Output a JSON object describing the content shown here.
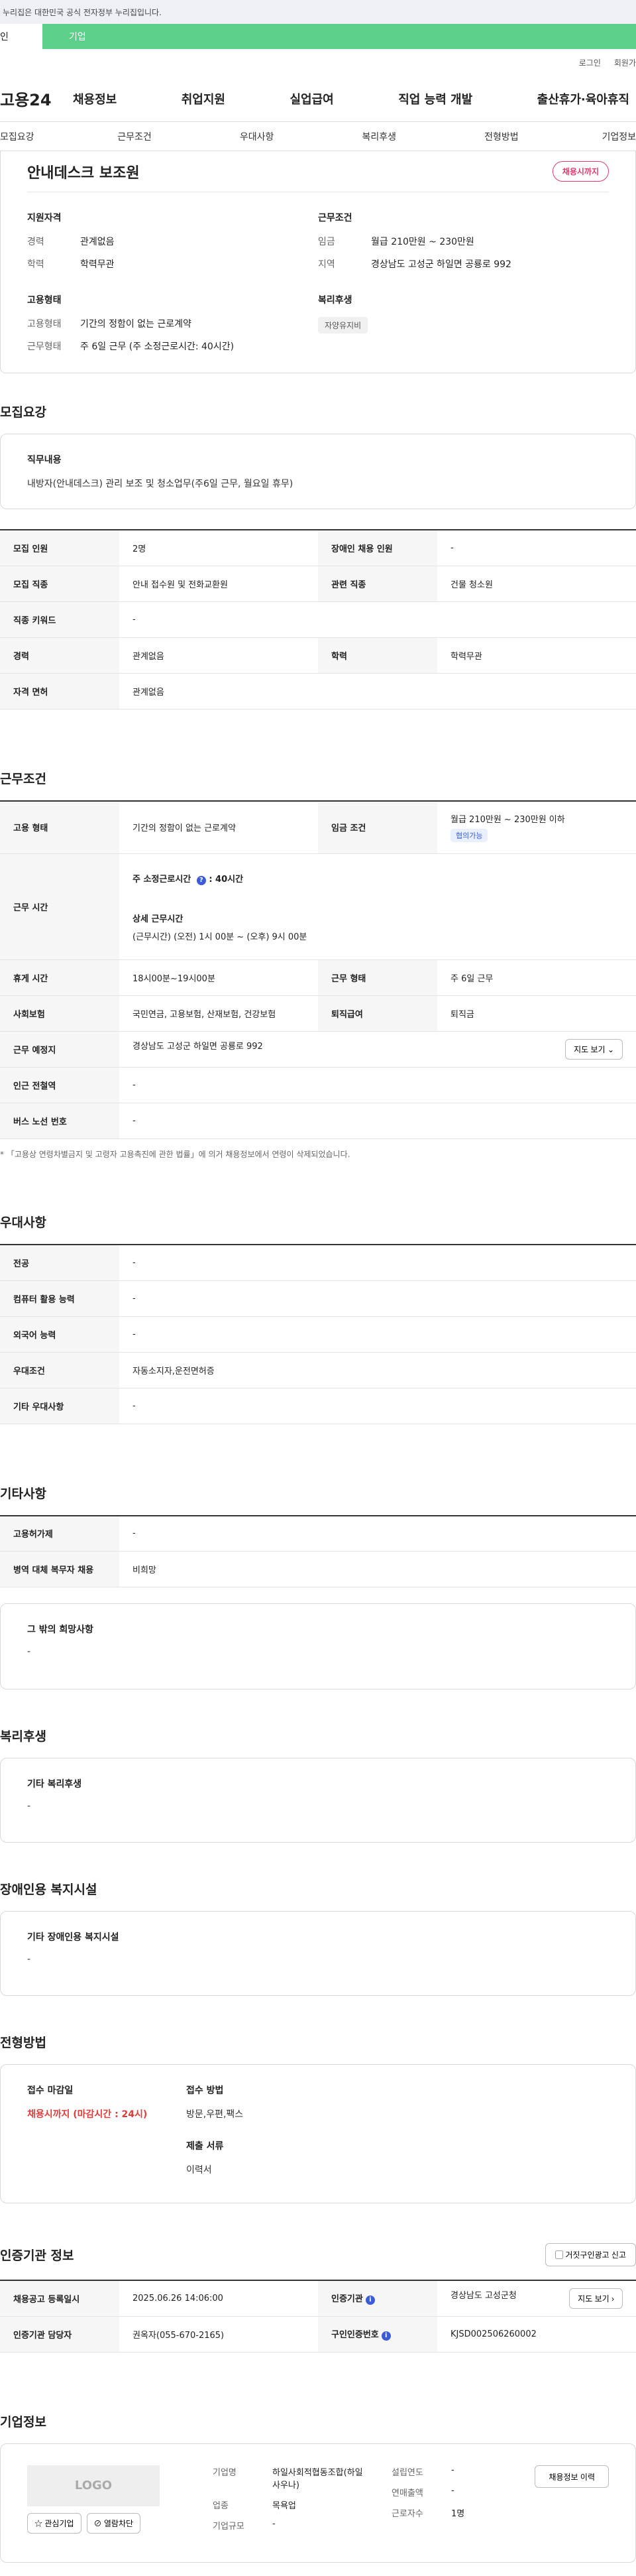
{
  "gov_bar": "누리집은 대한민국 공식 전자정부 누리집입니다.",
  "user_tabs": {
    "individual": "인",
    "company": "기업"
  },
  "util": {
    "login": "로그인",
    "join": "회원가"
  },
  "logo": "고용24",
  "gnb": [
    "채용정보",
    "취업지원",
    "실업급여",
    "직업 능력 개발",
    "출산휴가·육아휴직"
  ],
  "subtabs": [
    "모집요강",
    "근무조건",
    "우대사항",
    "복리후생",
    "전형방법",
    "기업정보"
  ],
  "summary": {
    "title": "안내데스크 보조원",
    "status": "채용시까지",
    "qual_title": "지원자격",
    "qual": [
      {
        "k": "경력",
        "v": "관계없음"
      },
      {
        "k": "학력",
        "v": "학력무관"
      }
    ],
    "cond_title": "근무조건",
    "cond": [
      {
        "k": "임금",
        "v": "월급 210만원 ~ 230만원"
      },
      {
        "k": "지역",
        "v": "경상남도 고성군 하일면 공룡로 992"
      }
    ],
    "emp_title": "고용형태",
    "emp": [
      {
        "k": "고용형태",
        "v": "기간의 정함이 없는 근로계약"
      },
      {
        "k": "근무형태",
        "v": "주 6일 근무 (주 소정근로시간: 40시간)"
      }
    ],
    "welfare_title": "복리후생",
    "welfare_chip": "자양유지비"
  },
  "recruit": {
    "section": "모집요강",
    "job_title": "직무내용",
    "job_text": "내방자(안내데스크) 관리 보조 및 청소업무(주6일 근무, 월요일 휴무)",
    "rows": [
      [
        {
          "k": "모집 인원",
          "v": "2명"
        },
        {
          "k": "장애인 채용 인원",
          "v": "-"
        }
      ],
      [
        {
          "k": "모집 직종",
          "v": "안내 접수원 및 전화교환원"
        },
        {
          "k": "관련 직종",
          "v": "건물 청소원"
        }
      ],
      [
        {
          "k": "직종 키워드",
          "v": "-"
        }
      ],
      [
        {
          "k": "경력",
          "v": "관계없음"
        },
        {
          "k": "학력",
          "v": "학력무관"
        }
      ],
      [
        {
          "k": "자격 면허",
          "v": "관계없음"
        }
      ]
    ]
  },
  "work": {
    "section": "근무조건",
    "emp_type_k": "고용 형태",
    "emp_type_v": "기간의 정함이 없는 근로계약",
    "wage_k": "임금 조건",
    "wage_v": "월급 210만원 ~ 230만원 이하",
    "wage_chip": "협의가능",
    "time_k": "근무 시간",
    "time_main": "주 소정근로시간",
    "time_main_v": ": 40시간",
    "time_detail_title": "상세 근무시간",
    "time_detail": "(근무시간) (오전) 1시 00분 ~ (오후) 9시 00분",
    "rest_k": "휴게 시간",
    "rest_v": "18시00분~19시00분",
    "form_k": "근무 형태",
    "form_v": "주 6일 근무",
    "ins_k": "사회보험",
    "ins_v": "국민연금, 고용보험, 산재보험, 건강보험",
    "sev_k": "퇴직급여",
    "sev_v": "퇴직금",
    "place_k": "근무 예정지",
    "place_v": "경상남도 고성군 하일면 공룡로 992",
    "map_btn": "지도 보기",
    "subway_k": "인근 전철역",
    "subway_v": "-",
    "bus_k": "버스 노선 번호",
    "bus_v": "-",
    "note": "* 「고용상 연령차별금지 및 고령자 고용촉진에 관한 법률」에 의거 채용정보에서 연령이 삭제되었습니다."
  },
  "pref": {
    "section": "우대사항",
    "rows": [
      {
        "k": "전공",
        "v": "-"
      },
      {
        "k": "컴퓨터 활용 능력",
        "v": "-"
      },
      {
        "k": "외국어 능력",
        "v": "-"
      },
      {
        "k": "우대조건",
        "v": "자동소지자,운전면허증"
      },
      {
        "k": "기타 우대사항",
        "v": "-"
      }
    ]
  },
  "etc": {
    "section": "기타사항",
    "rows": [
      {
        "k": "고용허가제",
        "v": "-"
      },
      {
        "k": "병역 대체 복무자 채용",
        "v": "비희망"
      }
    ],
    "box_title": "그 밖의 희망사항",
    "box_text": "-"
  },
  "welfare": {
    "section": "복리후생",
    "box_title": "기타 복리후생",
    "box_text": "-"
  },
  "disabled": {
    "section": "장애인용 복지시설",
    "box_title": "기타 장애인용 복지시설",
    "box_text": "-"
  },
  "selection": {
    "section": "전형방법",
    "deadline_title": "접수 마감일",
    "deadline_v": "채용시까지 (마감시간 : 24시)",
    "method_title": "접수 방법",
    "method_v": "방문,우편,팩스",
    "docs_title": "제출 서류",
    "docs_v": "이력서"
  },
  "agency": {
    "section": "인증기관 정보",
    "report_btn": "거짓구인광고 신고",
    "reg_k": "채용공고 등록일시",
    "reg_v": "2025.06.26 14:06:00",
    "org_k": "인증기관",
    "org_v": "경상남도 고성군청",
    "map_btn": "지도 보기",
    "mgr_k": "인증기관 담당자",
    "mgr_v": "권옥자(055-670-2165)",
    "no_k": "구인인증번호",
    "no_v": "KJSD002506260002"
  },
  "company": {
    "section": "기업정보",
    "logo": "LOGO",
    "fav_btn": "관심기업",
    "block_btn": "열람차단",
    "name_k": "기업명",
    "name_v": "하일사회적협동조합(하일사우나)",
    "type_k": "업종",
    "type_v": "목욕업",
    "size_k": "기업규모",
    "size_v": "-",
    "est_k": "설립연도",
    "est_v": "-",
    "sales_k": "연매출액",
    "sales_v": "-",
    "emp_k": "근로자수",
    "emp_v": "1명",
    "history_btn": "채용정보 이력"
  }
}
